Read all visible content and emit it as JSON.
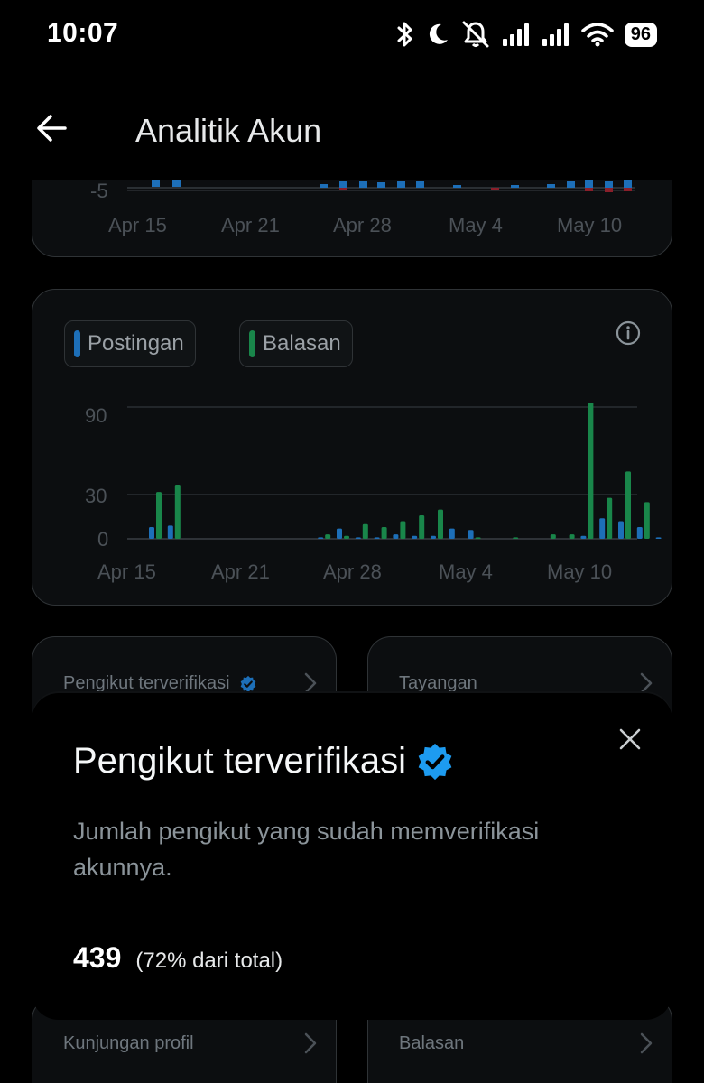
{
  "status_bar": {
    "time": "10:07",
    "battery": "96",
    "icons": [
      "bluetooth-icon",
      "moon-icon",
      "bell-off-icon",
      "signal-icon",
      "signal-icon",
      "wifi-icon",
      "battery-icon"
    ]
  },
  "header": {
    "title": "Analitik Akun",
    "back_icon": "arrow-left-icon"
  },
  "top_chart": {
    "y_label": "-5",
    "x_labels": [
      "Apr 15",
      "Apr 21",
      "Apr 28",
      "May 4",
      "May 10"
    ]
  },
  "chart_data": {
    "type": "bar",
    "legend": [
      {
        "name": "Postingan",
        "color": "#1d6fb8"
      },
      {
        "name": "Balasan",
        "color": "#19864a"
      }
    ],
    "y_ticks": [
      "90",
      "30",
      "0"
    ],
    "x_labels": [
      "Apr 15",
      "Apr 21",
      "Apr 28",
      "May 4",
      "May 10"
    ],
    "ylim": [
      0,
      95
    ],
    "categories": [
      "Apr 15",
      "Apr 16",
      "Apr 17",
      "Apr 18",
      "Apr 19",
      "Apr 20",
      "Apr 21",
      "Apr 22",
      "Apr 23",
      "Apr 24",
      "Apr 25",
      "Apr 26",
      "Apr 27",
      "Apr 28",
      "Apr 29",
      "Apr 30",
      "May 1",
      "May 2",
      "May 3",
      "May 4",
      "May 5",
      "May 6",
      "May 7",
      "May 8",
      "May 9",
      "May 10",
      "May 11",
      "May 12",
      "May 13"
    ],
    "series": [
      {
        "name": "Postingan",
        "values": [
          8,
          9,
          0,
          0,
          0,
          0,
          0,
          0,
          0,
          1,
          7,
          1,
          1,
          3,
          2,
          2,
          7,
          6,
          0,
          0,
          0,
          0,
          0,
          2,
          14,
          12,
          8,
          1,
          1
        ]
      },
      {
        "name": "Balasan",
        "values": [
          32,
          37,
          0,
          0,
          0,
          0,
          0,
          0,
          0,
          3,
          2,
          10,
          8,
          12,
          16,
          20,
          0,
          1,
          0,
          1,
          0,
          3,
          3,
          93,
          28,
          46,
          25,
          0,
          0
        ]
      }
    ]
  },
  "cards": [
    {
      "label": "Pengikut terverifikasi",
      "verified": true
    },
    {
      "label": "Tayangan",
      "verified": false
    },
    {
      "label": "Kunjungan profil",
      "verified": false
    },
    {
      "label": "Balasan",
      "verified": false
    }
  ],
  "sheet": {
    "title": "Pengikut terverifikasi",
    "description": "Jumlah pengikut yang sudah memverifikasi akunnya.",
    "value": "439",
    "percent_text": "(72% dari total)"
  },
  "colors": {
    "background": "#000000",
    "card": "#0c0e10",
    "border": "#2f3336",
    "postingan": "#1d6fb8",
    "balasan": "#19864a",
    "verified_badge": "#1d9bf0",
    "negative": "#8a1f2a"
  }
}
